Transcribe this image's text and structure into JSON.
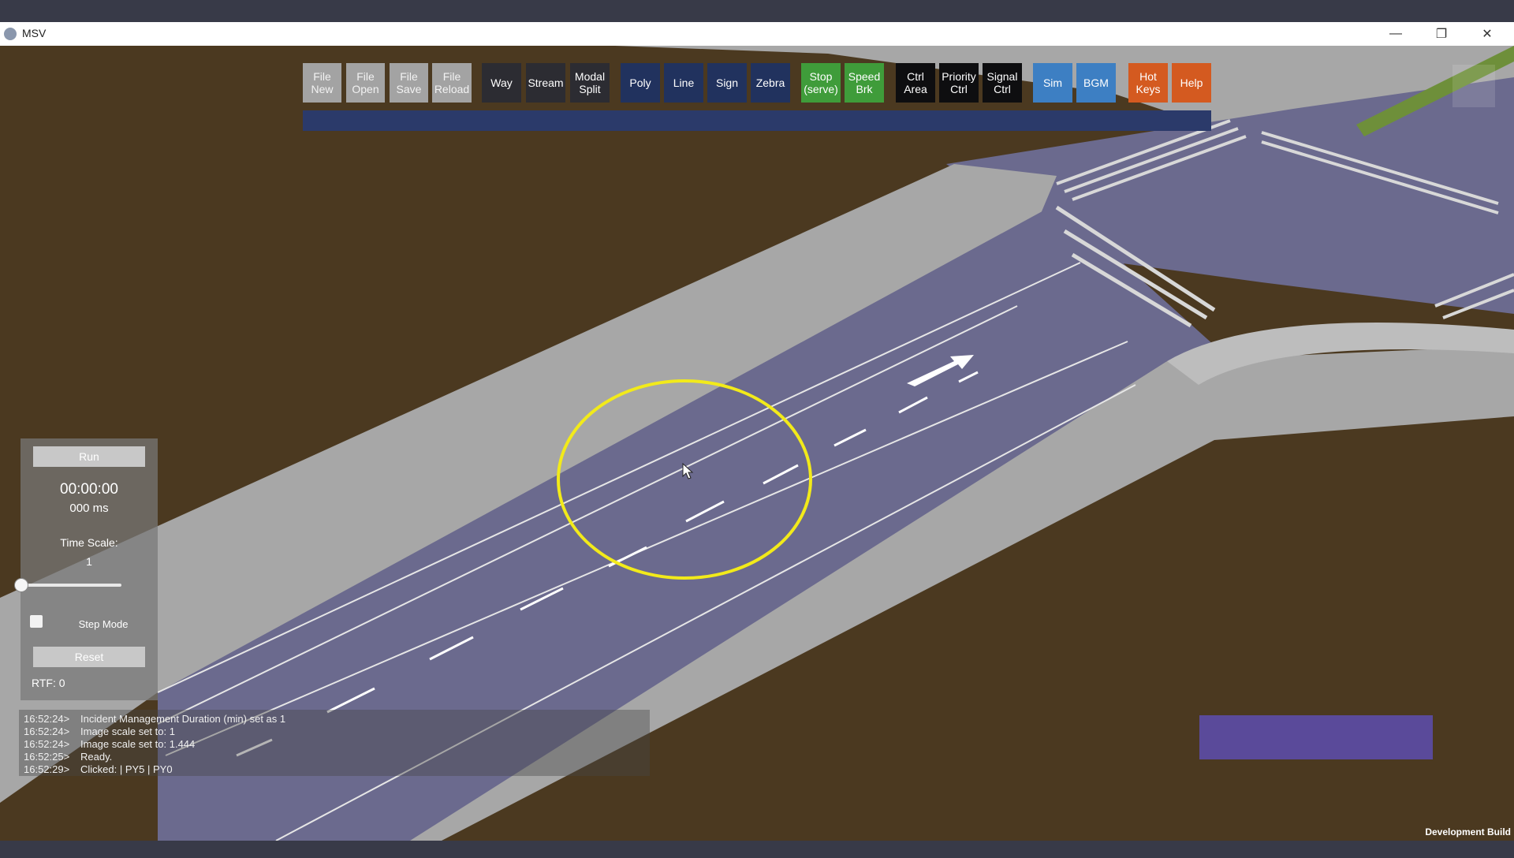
{
  "window": {
    "title": "MSV",
    "minimize_glyph": "—",
    "maximize_glyph": "❐",
    "close_glyph": "✕"
  },
  "toolbar": {
    "file_new": "File\nNew",
    "file_open": "File\nOpen",
    "file_save": "File\nSave",
    "file_reload": "File\nReload",
    "way": "Way",
    "stream": "Stream",
    "modal_split": "Modal\nSplit",
    "poly": "Poly",
    "line": "Line",
    "sign": "Sign",
    "zebra": "Zebra",
    "stop_serve": "Stop\n(serve)",
    "speed_brk": "Speed\nBrk",
    "ctrl_area": "Ctrl\nArea",
    "priority_ctrl": "Priority\nCtrl",
    "signal_ctrl": "Signal\nCtrl",
    "sim": "Sim",
    "bgm": "BGM",
    "hot_keys": "Hot\nKeys",
    "help": "Help"
  },
  "sim_panel": {
    "run_label": "Run",
    "clock": "00:00:00",
    "ms": "000 ms",
    "time_scale_label": "Time Scale:",
    "time_scale_value": "1",
    "step_mode_label": "Step Mode",
    "reset_label": "Reset",
    "rtf": "RTF: 0",
    "time_scale_fraction": 0
  },
  "console": [
    {
      "ts": "16:52:24>",
      "msg": "Incident Management Duration (min) set as 1"
    },
    {
      "ts": "16:52:24>",
      "msg": "Image scale set to: 1"
    },
    {
      "ts": "16:52:24>",
      "msg": "Image scale set to: 1.444"
    },
    {
      "ts": "16:52:25>",
      "msg": "Ready."
    },
    {
      "ts": "16:52:29>",
      "msg": "Clicked:  | PY5 | PY0"
    }
  ],
  "status": {
    "dev_build": "Development Build"
  },
  "colors": {
    "ground": "#4b3920",
    "road": "#6b6a8e",
    "sidewalk": "#a7a7a7",
    "highlight_circle": "#f2ea1a"
  }
}
